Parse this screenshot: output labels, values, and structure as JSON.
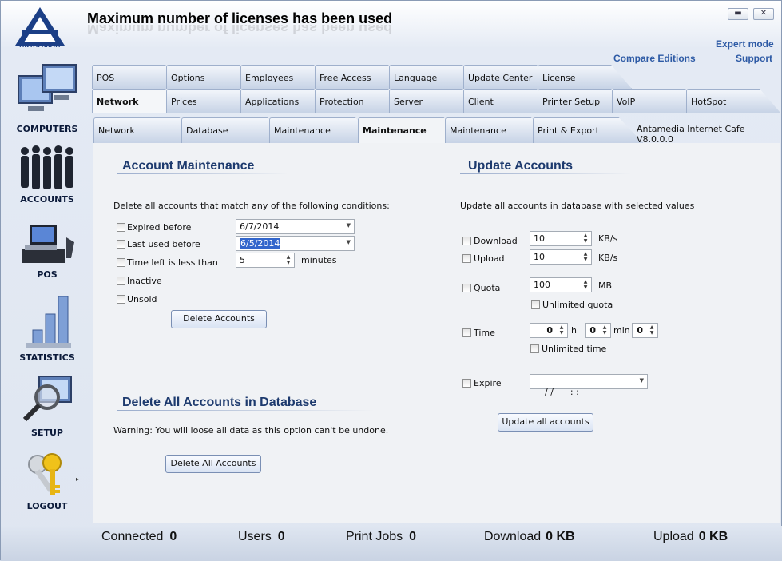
{
  "window": {
    "title": "Maximum number of licenses has been used",
    "logo_text": "ANTAMEDIA",
    "minimize_label": "▬",
    "close_label": "✕"
  },
  "top_links": {
    "expert_mode": "Expert mode",
    "compare_editions": "Compare Editions",
    "support": "Support"
  },
  "sidebar": {
    "items": [
      {
        "label": "COMPUTERS"
      },
      {
        "label": "ACCOUNTS"
      },
      {
        "label": "POS"
      },
      {
        "label": "STATISTICS"
      },
      {
        "label": "SETUP"
      },
      {
        "label": "LOGOUT"
      }
    ]
  },
  "tabs": {
    "row1": [
      "POS",
      "Options",
      "Employees",
      "Free Access",
      "Language",
      "Update Center",
      "License"
    ],
    "row2": [
      "Network",
      "Prices",
      "Applications",
      "Protection",
      "Server",
      "Client",
      "Printer Setup",
      "VoIP",
      "HotSpot"
    ],
    "row3": [
      "Network",
      "Database",
      "Maintenance",
      "Maintenance",
      "Maintenance",
      "Print & Export"
    ],
    "version": "Antamedia Internet Cafe V8.0.0.0"
  },
  "account_maintenance": {
    "title": "Account Maintenance",
    "description": "Delete all accounts that match any of the following conditions:",
    "expired_before_label": "Expired before",
    "expired_before_value": "6/7/2014",
    "last_used_before_label": "Last used before",
    "last_used_before_value": "6/5/2014",
    "time_left_label": "Time left is less than",
    "time_left_value": "5",
    "time_left_unit": "minutes",
    "inactive_label": "Inactive",
    "unsold_label": "Unsold",
    "delete_button": "Delete Accounts"
  },
  "delete_all": {
    "title": "Delete All Accounts in Database",
    "warning": "Warning: You will loose all data as this option can't be undone.",
    "button": "Delete All Accounts"
  },
  "update_accounts": {
    "title": "Update Accounts",
    "description": "Update all accounts in database with selected values",
    "download_label": "Download",
    "download_value": "10",
    "download_unit": "KB/s",
    "upload_label": "Upload",
    "upload_value": "10",
    "upload_unit": "KB/s",
    "quota_label": "Quota",
    "quota_value": "100",
    "quota_unit": "MB",
    "unlimited_quota_label": "Unlimited quota",
    "time_label": "Time",
    "time_h_value": "0",
    "time_h_unit": "h",
    "time_m_value": "0",
    "time_m_unit": "min",
    "time_s_value": "0",
    "unlimited_time_label": "Unlimited time",
    "expire_label": "Expire",
    "expire_value": "/ /      : :",
    "button": "Update all accounts"
  },
  "status_bar": {
    "connected_label": "Connected",
    "connected_value": "0",
    "users_label": "Users",
    "users_value": "0",
    "print_jobs_label": "Print Jobs",
    "print_jobs_value": "0",
    "download_label": "Download",
    "download_value": "0 KB",
    "upload_label": "Upload",
    "upload_value": "0 KB"
  }
}
